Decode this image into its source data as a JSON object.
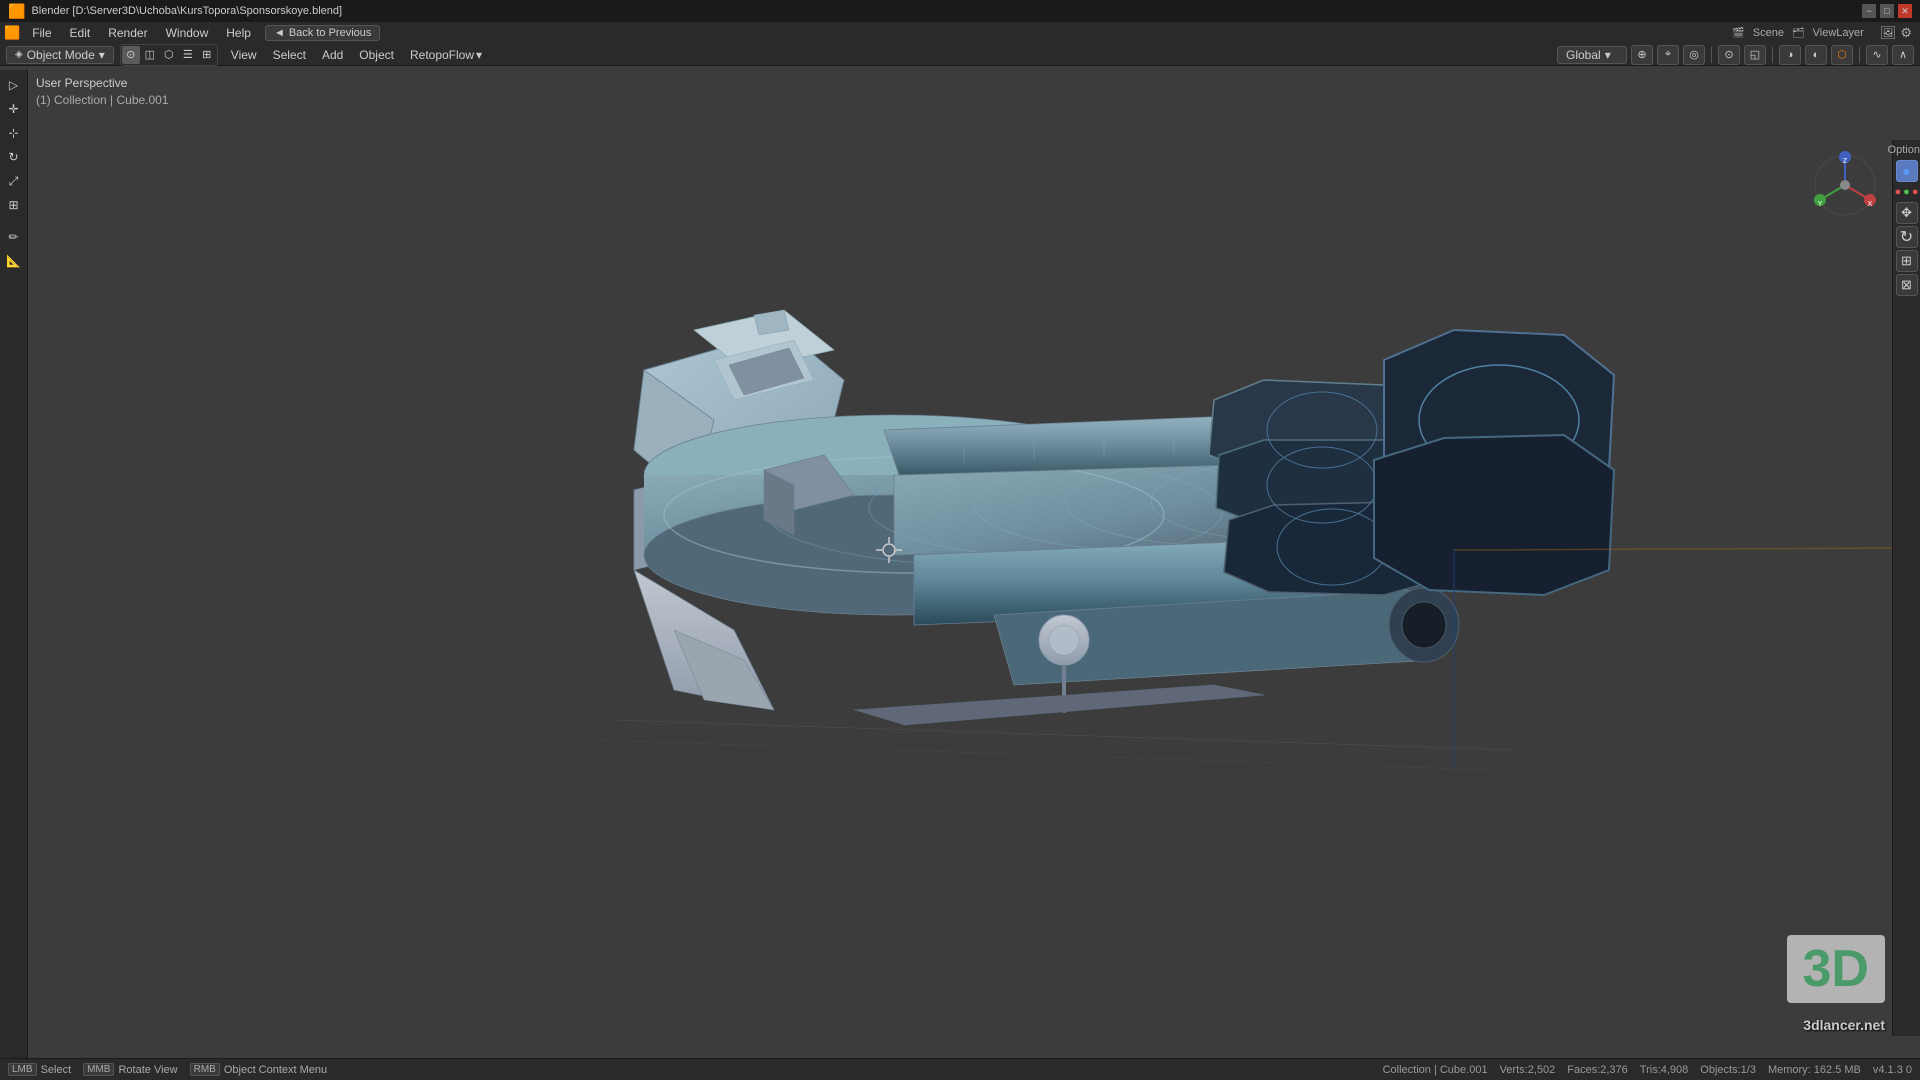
{
  "window": {
    "title": "Blender [D:\\Server3D\\Uchoba\\KursTopora\\Sponsorskoye.blend]",
    "controls": {
      "minimize": "−",
      "maximize": "□",
      "close": "✕"
    }
  },
  "menu_bar": {
    "items": [
      "Blender",
      "File",
      "Edit",
      "Render",
      "Window",
      "Help"
    ],
    "back_button": "Back to Previous",
    "back_icon": "◄",
    "right": {
      "scene_label": "Scene",
      "view_layer_label": "ViewLayer"
    }
  },
  "toolbar": {
    "mode": "Object Mode",
    "mode_arrow": "▾",
    "items": [
      "View",
      "Select",
      "Add",
      "Object",
      "RetopoFlow"
    ],
    "retopo_arrow": "▾",
    "right_icons": [
      {
        "name": "global-transform",
        "icon": "⊕"
      },
      {
        "name": "snap",
        "icon": "⌖"
      },
      {
        "name": "proportional",
        "icon": "◎"
      },
      {
        "name": "overlay",
        "icon": "⊙"
      },
      {
        "name": "xray",
        "icon": "◫"
      },
      {
        "name": "shading1",
        "icon": "◑"
      },
      {
        "name": "shading2",
        "icon": "◐"
      },
      {
        "name": "shading3",
        "icon": "⬡"
      },
      {
        "name": "shading4",
        "icon": "🔆"
      }
    ]
  },
  "viewport": {
    "perspective_label": "User Perspective",
    "collection_label": "(1) Collection | Cube.001"
  },
  "right_panel": {
    "options_label": "Options",
    "buttons": [
      {
        "name": "circle-blue",
        "icon": "●",
        "color": "#5a9af5"
      },
      {
        "name": "circle-red",
        "icon": "●",
        "color": "#e05050"
      },
      {
        "name": "circle-green",
        "icon": "●",
        "color": "#50c050"
      },
      {
        "name": "circle-red2",
        "icon": "●",
        "color": "#e05050"
      },
      {
        "name": "tool1",
        "icon": "✥"
      },
      {
        "name": "tool2",
        "icon": "⟲"
      },
      {
        "name": "tool3",
        "icon": "⊞"
      },
      {
        "name": "tool4",
        "icon": "⊠"
      }
    ]
  },
  "watermark": {
    "logo": "3D",
    "domain": "3dlancer.net"
  },
  "status_bar": {
    "items": [
      {
        "key": "LMB",
        "label": "Select"
      },
      {
        "key": "MMB",
        "label": "Rotate View"
      },
      {
        "key": "RMB",
        "label": "Object Context Menu"
      }
    ],
    "right": {
      "collection": "Collection | Cube.001",
      "verts": "Verts:2,502",
      "faces": "Faces:2,376",
      "tris": "Tris:4,908",
      "objects": "Objects:1/3",
      "memory": "Memory: 162.5 MB",
      "version": "v4.1.3 0"
    }
  }
}
